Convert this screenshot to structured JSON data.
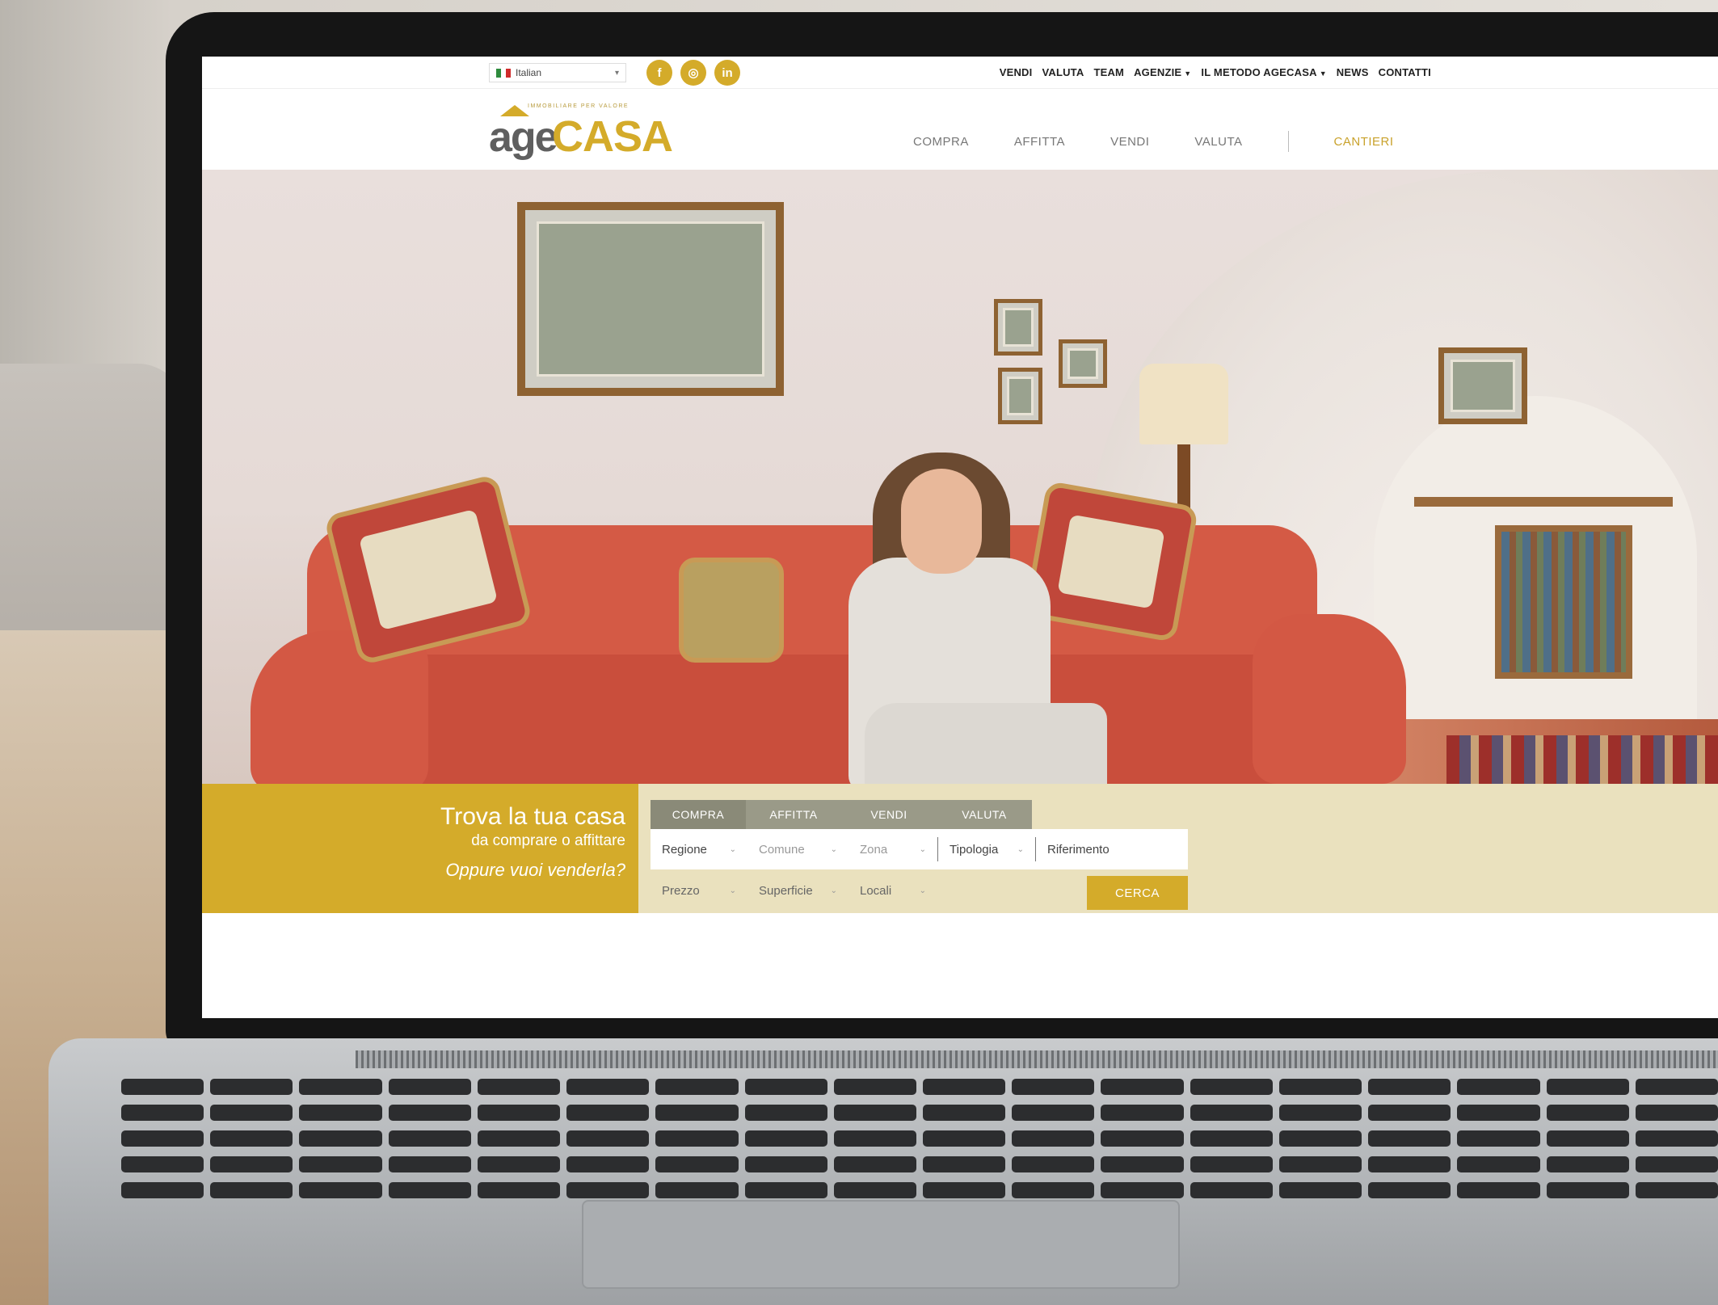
{
  "topbar": {
    "language": "Italian",
    "social": [
      {
        "icon": "facebook-icon",
        "glyph": "f"
      },
      {
        "icon": "instagram-icon",
        "glyph": "◎"
      },
      {
        "icon": "linkedin-icon",
        "glyph": "in"
      }
    ],
    "nav": [
      "VENDI",
      "VALUTA",
      "TEAM",
      "AGENZIE",
      "IL METODO AGECASA",
      "NEWS",
      "CONTATTI"
    ]
  },
  "logo": {
    "tagline": "IMMOBILIARE PER VALORE",
    "age": "age",
    "casa": "CASA"
  },
  "mainnav": {
    "items": [
      "COMPRA",
      "AFFITTA",
      "VENDI",
      "VALUTA"
    ],
    "cantieri": "CANTIERI"
  },
  "search": {
    "promo_title": "Trova la tua casa",
    "promo_subtitle": "da comprare o affittare",
    "promo_sell": "Oppure vuoi venderla?",
    "tabs": [
      "COMPRA",
      "AFFITTA",
      "VENDI",
      "VALUTA"
    ],
    "row1": {
      "regione": "Regione",
      "comune": "Comune",
      "zona": "Zona",
      "tipologia": "Tipologia",
      "riferimento": "Riferimento"
    },
    "row2": {
      "prezzo": "Prezzo",
      "superficie": "Superficie",
      "locali": "Locali"
    },
    "button": "CERCA"
  },
  "colors": {
    "brand_gold": "#d4ab2a",
    "logo_gray": "#5f5f5f",
    "search_band": "#eae1be",
    "tab_gray": "#9a9a88"
  }
}
